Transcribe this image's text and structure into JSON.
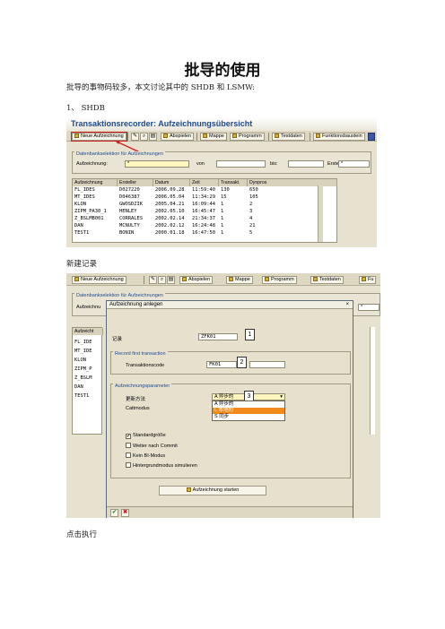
{
  "doc": {
    "title": "批导的使用",
    "intro": "批导的事物码较多，本文讨论其中的 SHDB 和 LSMW:",
    "section1": "1、  SHDB",
    "caption1": "新建记录",
    "caption2": "点击执行"
  },
  "screen1": {
    "title": "Transaktionsrecorder: Aufzeichnungsübersicht",
    "toolbar": [
      "Neue Aufzeichnung",
      "Abspielen",
      "Mappe",
      "Programm",
      "Testdaten",
      "Funktionsbaustein"
    ],
    "group_title": "Datenbankselektion für Aufzeichnungen",
    "aufz_label": "Aufzeichnung:",
    "aufz_value": "*",
    "von_label": "von",
    "bis_label": "bis:",
    "ersteller_label": "Ersteller:",
    "ersteller_value": "*",
    "columns": [
      "Aufzeichnung",
      "Ersteller",
      "Datum",
      "Zeit",
      "Transakt.",
      "Dynpros"
    ],
    "rows": [
      [
        "FL_IDES",
        "D027220",
        "2006.09.28",
        "11:59:40",
        "130",
        "650"
      ],
      [
        "MT_IDES",
        "D046387",
        "2006.05.04",
        "11:34:29",
        "15",
        "105"
      ],
      [
        "KLON",
        "GWOSDZIK",
        "2005.04.21",
        "16:09:44",
        "1",
        "2"
      ],
      [
        "ZIPM_PA30_1",
        "HENLEY",
        "2002.05.10",
        "16:45:47",
        "1",
        "3"
      ],
      [
        "Z_BSLMB001",
        "CORRALES",
        "2002.02.14",
        "21:34:37",
        "1",
        "4"
      ],
      [
        "DAN",
        "MCNULTY",
        "2002.02.12",
        "16:24:48",
        "1",
        "21"
      ],
      [
        "TEST1",
        "BONIN",
        "2000.01.18",
        "16:47:50",
        "1",
        "5"
      ]
    ]
  },
  "screen2": {
    "toolbar": [
      "Neue Aufzeichnung",
      "Abspielen",
      "Mappe",
      "Programm",
      "Testdaten",
      "Fu"
    ],
    "group_title": "Datenbankselektion für Aufzeichnungen",
    "aufz_label": "Aufzeichnu",
    "bg_col_header": "Aufzeicht",
    "bg_rows": [
      "FL_IDE",
      "MT_IDE",
      "KLON",
      "ZIPM_P",
      "Z_BSLM",
      "DAN",
      "TEST1"
    ],
    "ersteller_value": "*",
    "dialog": {
      "title": "Aufzeichnung anlegen",
      "close": "×",
      "record_label": "记录",
      "record_value": "ZFK01",
      "callout1": "1",
      "first_tx_title": "Record first transaction",
      "tcode_label": "Transaktionscode",
      "tcode_value": "FK01",
      "callout2": "2",
      "params_title": "Aufzeichnungsparameter",
      "update_label": "更新方法",
      "update_value": "A 异步的",
      "callout3": "3",
      "catt_label": "Cattmodus",
      "options": [
        "A 异步的",
        "L 本地的",
        "S 同步"
      ],
      "std_label": "Standardgröße",
      "std_check": "✔",
      "commit_label": "Weiter nach Commit",
      "bi_label": "Kein BI-Modus",
      "bg_label": "Hintergrundmodus simulieren",
      "start_button": "Aufzeichnung starten",
      "ok": "✔",
      "cancel": "✖"
    }
  },
  "colors": {
    "title_blue": "#1e4a8c",
    "highlight": "#f08a1a",
    "arrow": "#d21f1f"
  }
}
